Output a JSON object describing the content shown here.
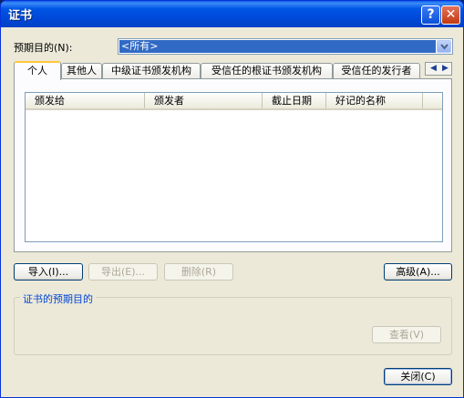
{
  "window": {
    "title": "证书",
    "help_label": "?",
    "close_glyph": "✕"
  },
  "purpose": {
    "label": "预期目的(N):",
    "selected": "<所有>"
  },
  "tabs": [
    {
      "label": "个人",
      "active": true
    },
    {
      "label": "其他人",
      "active": false
    },
    {
      "label": "中级证书颁发机构",
      "active": false
    },
    {
      "label": "受信任的根证书颁发机构",
      "active": false
    },
    {
      "label": "受信任的发行者",
      "active": false
    }
  ],
  "tab_scroll": {
    "left": "◀",
    "right": "▶"
  },
  "columns": [
    "颁发给",
    "颁发者",
    "截止日期",
    "好记的名称"
  ],
  "rows": [],
  "buttons": {
    "import": "导入(I)...",
    "export": "导出(E)...",
    "remove": "删除(R)",
    "advanced": "高级(A)...",
    "view": "查看(V)",
    "close": "关闭(C)"
  },
  "group": {
    "title": "证书的预期目的"
  },
  "colors": {
    "accent": "#316AC5",
    "group_title": "#0046D5",
    "active_tab": "#FFC83C"
  }
}
